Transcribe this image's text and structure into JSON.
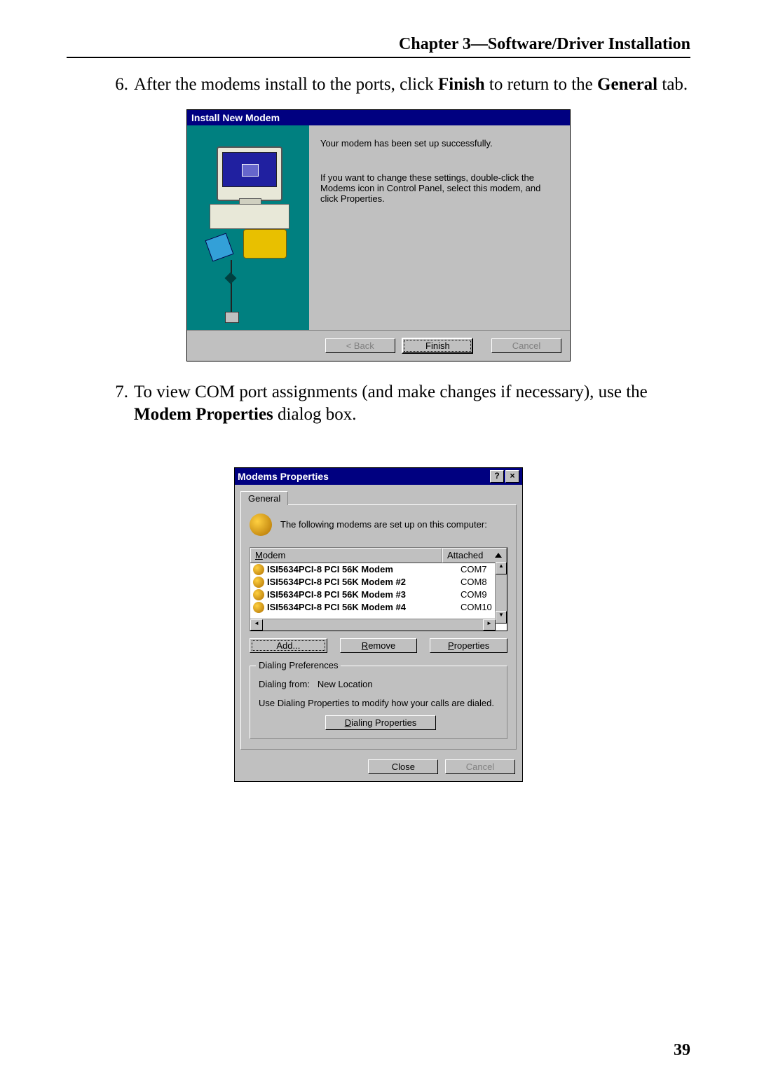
{
  "header": "Chapter 3—Software/Driver Installation",
  "page_number": "39",
  "step6": {
    "num": "6.",
    "pre": "After the modems install to the ports, click ",
    "bold1": "Finish",
    "mid": " to return to the ",
    "bold2": "General",
    "post": " tab."
  },
  "step7": {
    "num": "7.",
    "pre": "To view COM port assignments (and make changes if necessary), use the ",
    "bold1": "Modem Properties",
    "post": " dialog box."
  },
  "wizard": {
    "title": "Install New Modem",
    "line1": "Your modem has been set up successfully.",
    "line2": "If you want to change these settings, double-click the Modems icon in Control Panel, select this modem, and click Properties.",
    "back": "< Back",
    "finish": "Finish",
    "cancel": "Cancel"
  },
  "props": {
    "title": "Modems Properties",
    "tab": "General",
    "intro": "The following modems are set up on this computer:",
    "col_modem": "Modem",
    "col_attached": "Attached",
    "rows": [
      {
        "name": "ISI5634PCI-8 PCI 56K Modem",
        "port": "COM7"
      },
      {
        "name": "ISI5634PCI-8 PCI 56K Modem #2",
        "port": "COM8"
      },
      {
        "name": "ISI5634PCI-8 PCI 56K Modem #3",
        "port": "COM9"
      },
      {
        "name": "ISI5634PCI-8 PCI 56K Modem #4",
        "port": "COM10"
      }
    ],
    "add": "Add...",
    "remove": "Remove",
    "properties": "Properties",
    "group_title": "Dialing Preferences",
    "from_label": "Dialing from:",
    "from_value": "New Location",
    "note": "Use Dialing Properties to modify how your calls are dialed.",
    "dp_btn": "Dialing Properties",
    "close": "Close",
    "cancel": "Cancel",
    "help_sym": "?",
    "close_sym": "×"
  }
}
